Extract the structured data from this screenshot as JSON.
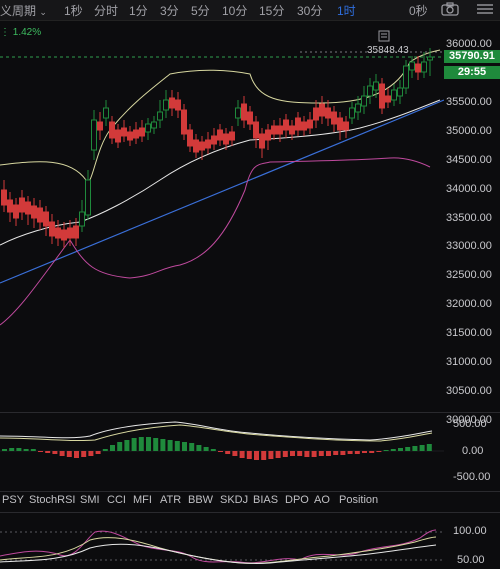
{
  "toolbar": {
    "period_label": "定义周期",
    "intervals": [
      "1秒",
      "分时",
      "1分",
      "3分",
      "5分",
      "10分",
      "15分",
      "30分",
      "1时"
    ],
    "active_interval": "1时",
    "countdown": "0秒",
    "accent_color": "#2f6fe0"
  },
  "main_chart": {
    "change_pct": "1.42%",
    "high_label": "35848.43",
    "current_price": "35790.91",
    "timer": "29:55",
    "y_axis": [
      "36000.00",
      "35500.00",
      "35000.00",
      "34500.00",
      "34000.00",
      "33500.00",
      "33000.00",
      "32500.00",
      "32000.00",
      "31500.00",
      "31000.00",
      "30500.00",
      "30000.00"
    ],
    "up_color": "#1f8a3c",
    "down_color": "#d23a3a"
  },
  "macd_panel": {
    "y_axis": [
      "500.00",
      "0.00",
      "-500.00"
    ]
  },
  "indicator_tabs": [
    "PSY",
    "StochRSI",
    "SMI",
    "CCI",
    "MFI",
    "ATR",
    "BBW",
    "SKDJ",
    "BIAS",
    "DPO",
    "AO",
    "Position"
  ],
  "stoch_panel": {
    "y_axis": [
      "100.00",
      "50.00"
    ]
  }
}
